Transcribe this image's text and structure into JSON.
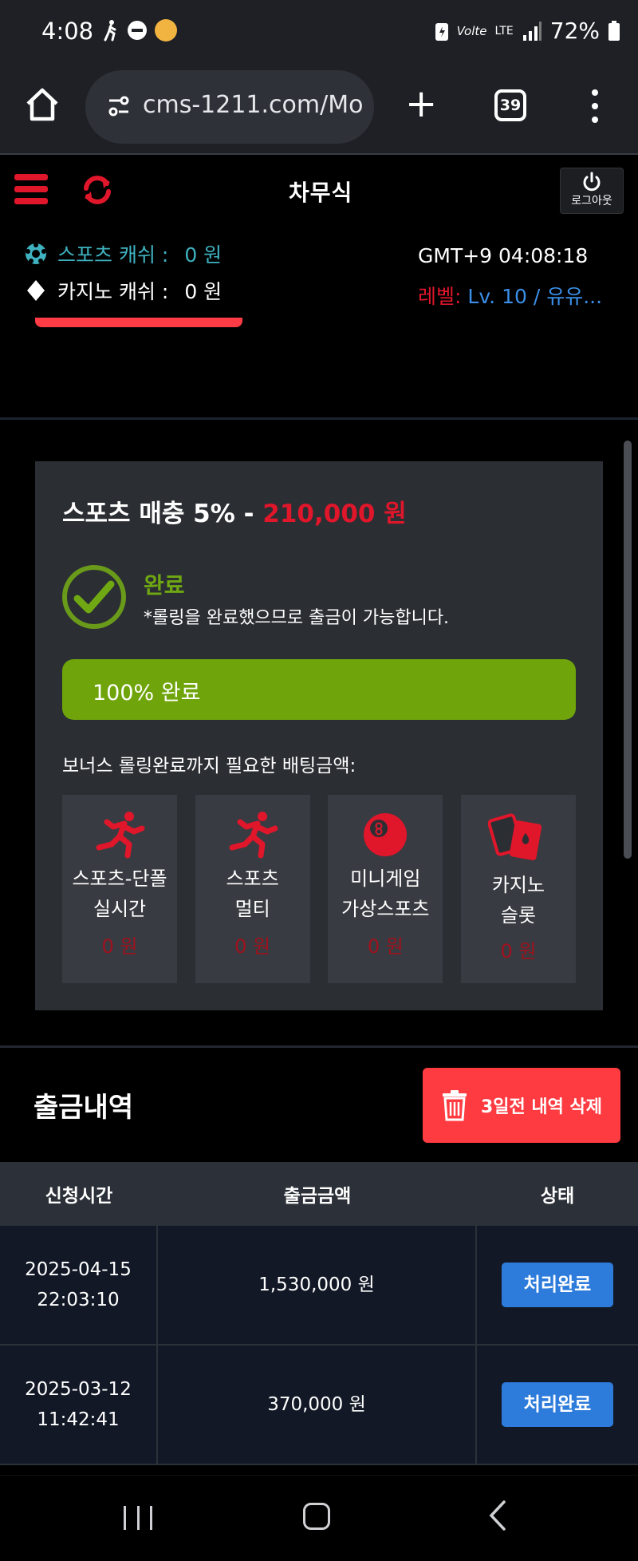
{
  "status_bar": {
    "time": "4:08",
    "network_label": "Volte",
    "network_type": "LTE",
    "battery": "72%"
  },
  "browser": {
    "url": "cms-1211.com/Mo",
    "tab_count": "39"
  },
  "header": {
    "logo": "차무식",
    "logout_label": "로그아웃",
    "sports_cash_label": "스포츠 캐쉬 :",
    "sports_cash_amount": "0 원",
    "casino_cash_label": "카지노 캐쉬 :",
    "casino_cash_amount": "0 원",
    "gmt": "GMT+9 04:08:18",
    "level_label": "레벨:",
    "level_value": "Lv. 10 / 유유..."
  },
  "bonus": {
    "title_prefix": "스포츠 매충 5% -",
    "title_amount": "210,000 원",
    "status_label": "완료",
    "status_desc": "*롤링을 완료했으므로 출금이 가능합니다.",
    "progress_value": 1.0,
    "progress_text": "100% 완료",
    "need_text": "보너스 롤링완료까지 필요한 배팅금액:",
    "games": [
      {
        "icon": "runner-icon",
        "line1": "스포츠-단폴",
        "line2": "실시간",
        "amount": "0 원"
      },
      {
        "icon": "runner-icon",
        "line1": "스포츠",
        "line2": "멀티",
        "amount": "0 원"
      },
      {
        "icon": "billiard-ball-icon",
        "line1": "미니게임",
        "line2": "가상스포츠",
        "amount": "0 원"
      },
      {
        "icon": "playing-cards-icon",
        "line1": "카지노",
        "line2": "슬롯",
        "amount": "0 원"
      }
    ]
  },
  "history": {
    "title": "출금내역",
    "delete_button": "3일전 내역 삭제",
    "columns": [
      "신청시간",
      "출금금액",
      "상태"
    ],
    "rows": [
      {
        "date": "2025-04-15",
        "time": "22:03:10",
        "amount": "1,530,000 원",
        "status": "처리완료"
      },
      {
        "date": "2025-03-12",
        "time": "11:42:41",
        "amount": "370,000 원",
        "status": "처리완료"
      }
    ]
  },
  "colors": {
    "accent_red": "#e0162b",
    "accent_green": "#6fa50b",
    "status_blue": "#2d7cdb",
    "sports_cyan": "#3fb2c0"
  }
}
